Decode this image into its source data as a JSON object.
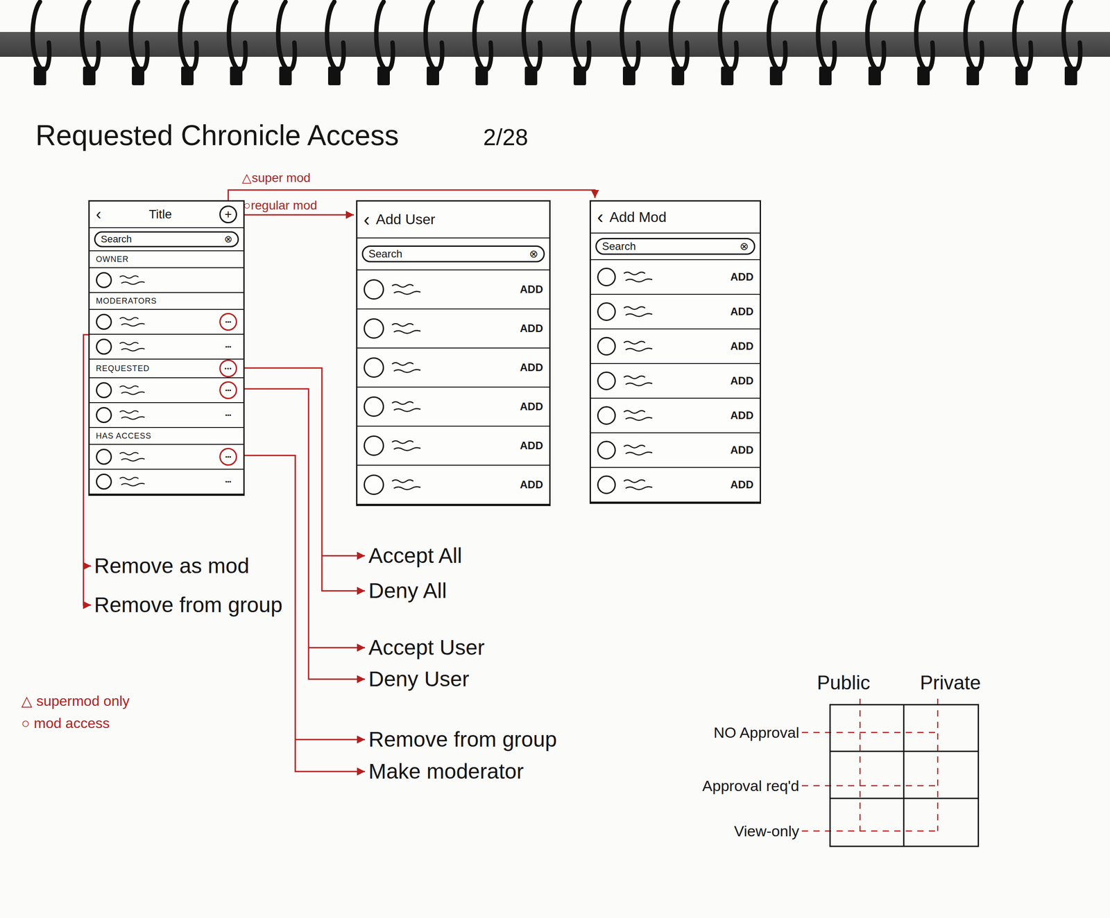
{
  "page": {
    "title": "Requested Chronicle Access",
    "date": "2/28"
  },
  "flow_labels": {
    "super_mod": "△super mod",
    "regular_mod": "○regular mod"
  },
  "group_screen": {
    "back": "‹",
    "title": "Title",
    "add": "+",
    "search": {
      "placeholder": "Search",
      "clear": "⊗"
    },
    "sections": [
      {
        "label": "OWNER",
        "rows": [
          {}
        ]
      },
      {
        "label": "MODERATORS",
        "rows": [
          {
            "menu": "•••",
            "circled": true
          },
          {
            "menu": "•••",
            "circled": false
          }
        ]
      },
      {
        "label": "REQUESTED",
        "menu": "•••",
        "circled": true,
        "rows": [
          {
            "menu": "•••",
            "circled": true
          },
          {
            "menu": "•••",
            "circled": false
          }
        ]
      },
      {
        "label": "HAS ACCESS",
        "rows": [
          {
            "menu": "•••",
            "circled": true
          },
          {
            "menu": "•••",
            "circled": false
          }
        ]
      }
    ]
  },
  "add_user_screen": {
    "back": "‹",
    "title": "Add User",
    "search": {
      "placeholder": "Search",
      "clear": "⊗"
    },
    "rows": [
      {
        "action": "ADD"
      },
      {
        "action": "ADD"
      },
      {
        "action": "ADD"
      },
      {
        "action": "ADD"
      },
      {
        "action": "ADD"
      },
      {
        "action": "ADD"
      }
    ]
  },
  "add_mod_screen": {
    "back": "‹",
    "title": "Add Mod",
    "search": {
      "placeholder": "Search",
      "clear": "⊗"
    },
    "rows": [
      {
        "action": "ADD"
      },
      {
        "action": "ADD"
      },
      {
        "action": "ADD"
      },
      {
        "action": "ADD"
      },
      {
        "action": "ADD"
      },
      {
        "action": "ADD"
      },
      {
        "action": "ADD"
      }
    ]
  },
  "menus": [
    {
      "items": [
        "Remove as mod",
        "Remove from group"
      ]
    },
    {
      "items": [
        "Accept All",
        "Deny All"
      ]
    },
    {
      "items": [
        "Accept User",
        "Deny User"
      ]
    },
    {
      "items": [
        "Remove from group",
        "Make moderator"
      ]
    }
  ],
  "legend": [
    "△ supermod only",
    "○ mod access"
  ],
  "matrix": {
    "columns": [
      "Public",
      "Private"
    ],
    "rows": [
      "NO Approval",
      "Approval req'd",
      "View-only"
    ]
  }
}
